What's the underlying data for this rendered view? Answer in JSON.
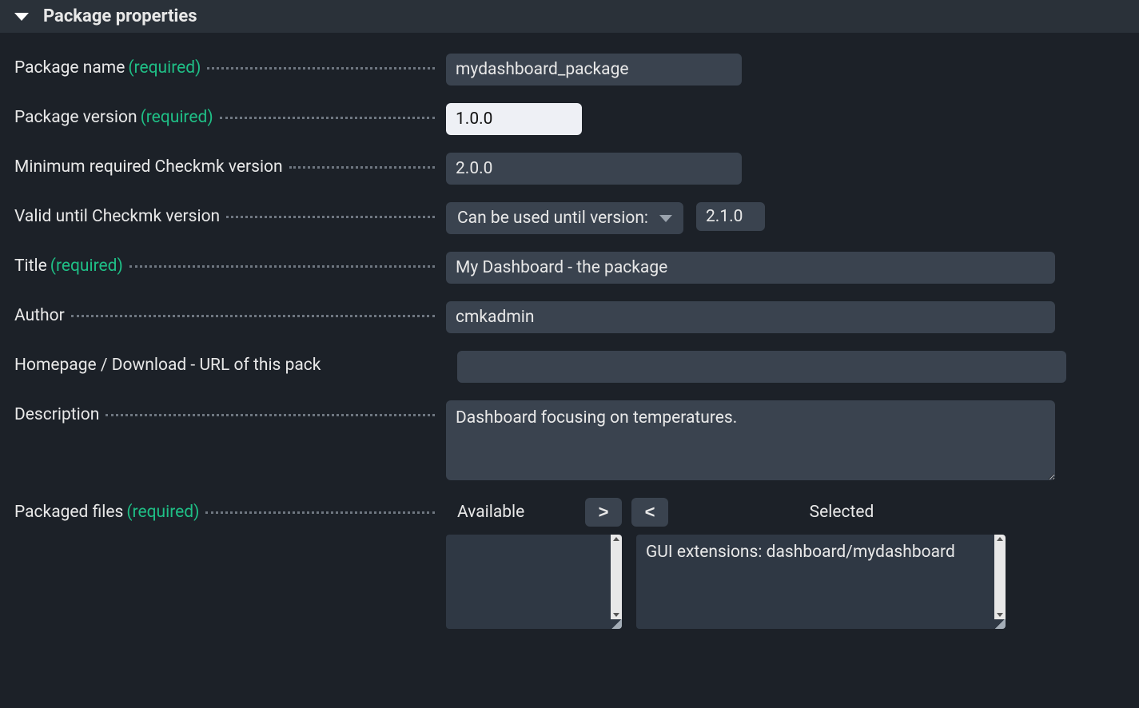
{
  "header": {
    "title": "Package properties"
  },
  "labels": {
    "package_name": "Package name",
    "package_version": "Package version",
    "min_version": "Minimum required Checkmk version",
    "valid_until": "Valid until Checkmk version",
    "title": "Title",
    "author": "Author",
    "homepage": "Homepage / Download - URL of this pack",
    "description": "Description",
    "packaged_files": "Packaged files",
    "required": "(required)"
  },
  "values": {
    "package_name": "mydashboard_package",
    "package_version": "1.0.0",
    "min_version": "2.0.0",
    "valid_until_select": "Can be used until version:",
    "valid_until_value": "2.1.0",
    "title": "My Dashboard - the package",
    "author": "cmkadmin",
    "homepage": "",
    "description": "Dashboard focusing on temperatures."
  },
  "files": {
    "available_header": "Available",
    "selected_header": "Selected",
    "move_right": ">",
    "move_left": "<",
    "available_items": [],
    "selected_items": [
      "GUI extensions: dashboard/mydashboard"
    ]
  }
}
